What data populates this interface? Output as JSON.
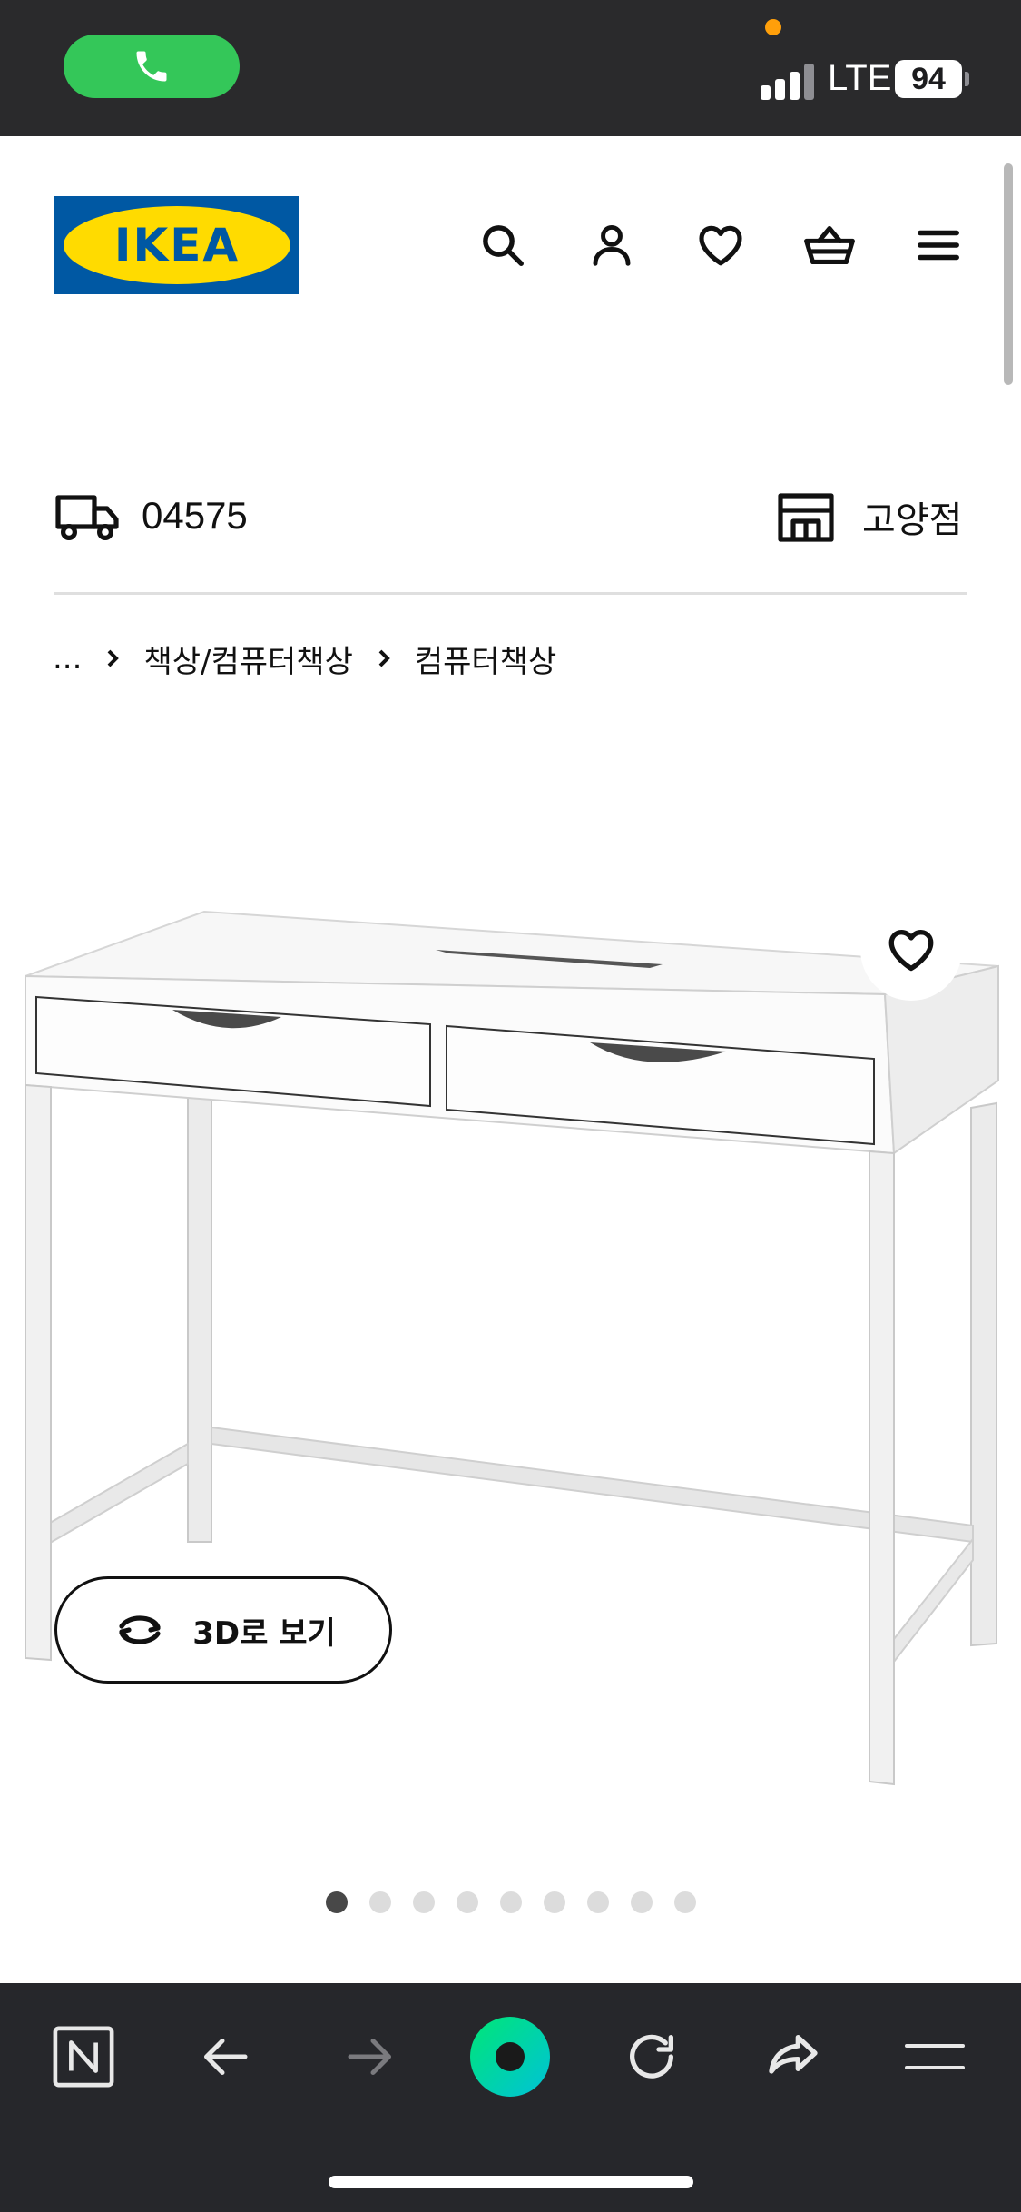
{
  "status_bar": {
    "network": "LTE",
    "battery": "94",
    "call_pill_color": "#34c759",
    "recording_dot_color": "#ff9f0a"
  },
  "header": {
    "logo_text": "IKEA",
    "icons": [
      "search-icon",
      "account-icon",
      "heart-icon",
      "cart-icon",
      "menu-icon"
    ]
  },
  "location": {
    "postal_code": "04575",
    "store_name": "고양점"
  },
  "breadcrumb": {
    "ellipsis": "...",
    "items": [
      "책상/컴퓨터책상",
      "컴퓨터책상"
    ]
  },
  "product": {
    "view_3d_label": "3D로 보기",
    "image_count": 9,
    "active_image": 1
  },
  "toolbar": {
    "icons": [
      "naver-n-icon",
      "back-arrow-icon",
      "forward-arrow-icon",
      "home-ring-icon",
      "reload-icon",
      "share-icon",
      "menu-lines-icon"
    ]
  },
  "colors": {
    "brand_blue": "#0058a3",
    "brand_yellow": "#ffdb00",
    "toolbar_bg": "#26272b",
    "status_bg": "#2a2a2c",
    "accent_green": "#00d67f"
  }
}
